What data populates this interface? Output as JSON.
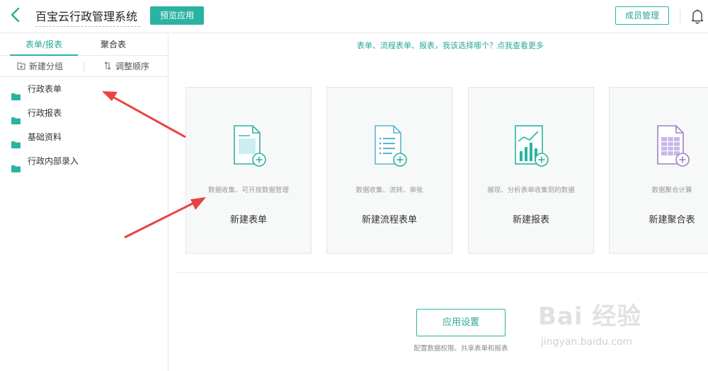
{
  "header": {
    "app_name": "百宝云行政管理系统",
    "preview_label": "预览应用",
    "member_label": "成员管理"
  },
  "sidebar": {
    "tabs": [
      {
        "label": "表单/报表",
        "active": true
      },
      {
        "label": "聚合表",
        "active": false
      }
    ],
    "tools": {
      "new_group": "新建分组",
      "reorder": "调整顺序"
    },
    "folders": [
      {
        "label": "行政表单"
      },
      {
        "label": "行政报表"
      },
      {
        "label": "基础资料"
      },
      {
        "label": "行政内部录入"
      }
    ]
  },
  "main": {
    "hint": "表单、流程表单、报表，我该选择哪个？点我查看更多",
    "cards": [
      {
        "icon": "form-add-icon",
        "desc": "数据收集、可开放数据管理",
        "title": "新建表单"
      },
      {
        "icon": "workflow-form-add-icon",
        "desc": "数据收集、流转、审批",
        "title": "新建流程表单"
      },
      {
        "icon": "report-add-icon",
        "desc": "展现、分析表单收集到的数据",
        "title": "新建报表"
      },
      {
        "icon": "aggregate-table-add-icon",
        "desc": "数据聚合计算",
        "title": "新建聚合表"
      }
    ],
    "settings_label": "应用设置",
    "settings_desc": "配置数据权限、共享表单和报表"
  },
  "colors": {
    "accent": "#2bb3a1",
    "accent_text": "#2aa89a",
    "arrow_red": "#e8433f"
  },
  "watermark": {
    "logo": "Bai 经验",
    "url": "jingyan.baidu.com"
  }
}
